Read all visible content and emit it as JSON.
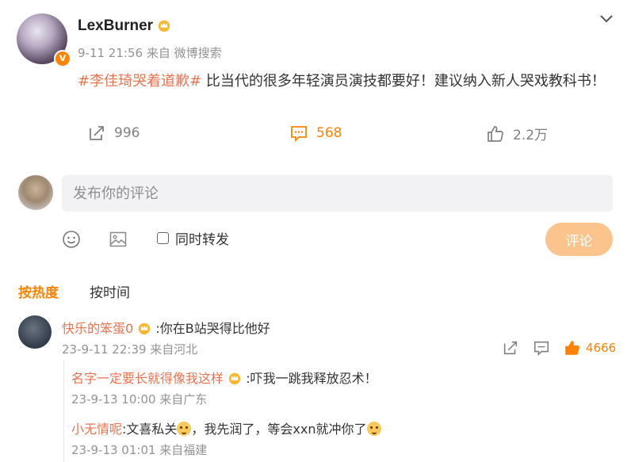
{
  "post": {
    "author": "LexBurner",
    "time": "9-11 21:56",
    "source": "来自 微博搜索",
    "topic": "#李佳琦哭着道歉#",
    "text": " 比当代的很多年轻演员演技都要好！建议纳入新人哭戏教科书！",
    "repost_count": "996",
    "comment_count": "568",
    "like_count": "2.2万"
  },
  "composer": {
    "placeholder": "发布你的评论",
    "repost_checkbox_label": "同时转发",
    "submit_label": "评论"
  },
  "sort": {
    "hot": "按热度",
    "time": "按时间"
  },
  "comments": [
    {
      "user": "快乐的笨蛋0",
      "text": ":你在B站哭得比他好",
      "time": "23-9-11 22:39 来自河北",
      "likes": "4666",
      "replies": [
        {
          "user": "名字一定要长就得像我这样",
          "text": ":吓我一跳我释放忍术！",
          "time": "23-9-13 10:00 来自广东"
        },
        {
          "user": "小无情呢",
          "text_a": ":文喜私关",
          "text_b": "，我先润了，等会xxn就冲你了",
          "time": "23-9-13 01:01 来自福建"
        }
      ]
    }
  ],
  "colors": {
    "accent": "#ff8200",
    "topic": "#eb7350",
    "submit_bg": "#fcc48d",
    "meta": "#939393"
  },
  "icons": [
    "chevron-down-icon",
    "crown-icon",
    "verified-icon",
    "repost-icon",
    "comment-icon",
    "like-icon",
    "emoji-icon",
    "image-icon",
    "share-icon",
    "reply-icon"
  ]
}
